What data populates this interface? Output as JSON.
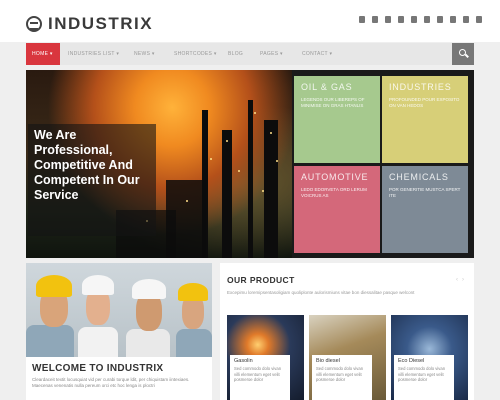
{
  "brand": {
    "name": "INDUSTRIX"
  },
  "social_icons": [
    "rss-icon",
    "facebook-icon",
    "twitter-icon",
    "google-plus-icon",
    "youtube-icon",
    "linkedin-icon",
    "dribbble-icon",
    "flickr-icon",
    "lock-icon",
    "user-icon"
  ],
  "nav": {
    "items": [
      {
        "label": "HOME ▾",
        "active": true
      },
      {
        "label": "INDUSTRIES LIST ▾",
        "active": false
      },
      {
        "label": "NEWS ▾",
        "active": false
      },
      {
        "label": "SHORTCODES ▾",
        "active": false
      },
      {
        "label": "BLOG",
        "active": false
      },
      {
        "label": "PAGES ▾",
        "active": false
      },
      {
        "label": "CONTACT ▾",
        "active": false
      }
    ]
  },
  "hero": {
    "lines": [
      "We Are",
      "Professional,",
      "Competitive And",
      "Competent In Our",
      "Service"
    ]
  },
  "tiles": [
    {
      "title": "OIL & GAS",
      "text": "LEGENDS OUR LIBEREPS OF MINIMISE ON GRAS HTANLIS"
    },
    {
      "title": "INDUSTRIES",
      "text": "PROFOUNDED POUR EXPOSITO ON VAN HEDOS"
    },
    {
      "title": "AUTOMOTIVE",
      "text": "LEDO EDORVETA ORD LERUM VOICRUS AS"
    },
    {
      "title": "CHEMICALS",
      "text": "POR GENERITIE MUSTCA SPERT ITE"
    }
  ],
  "welcome": {
    "title": "WELCOME TO INDUSTRIX",
    "text": "Cleardaceit textit locusquiat vid per curabi torque ldit, per chiquistam iintexiaes. Maecenas venenatis nulla pereum orci etc hoc lenga is ploctri"
  },
  "product": {
    "title": "OUR PRODUCT",
    "intro": "Excepimu loremipsentasoligiam quoliplonte aulorismiuns vitae bon diessalitae pasque welcont",
    "cards": [
      {
        "title": "Gasolin",
        "text": "Sed commodo dolo vivan villi elementum eget velit posmeroe dolor"
      },
      {
        "title": "Bio diesel",
        "text": "Sed commodo dolo vivan villi elementum eget velit posmeroe dolor"
      },
      {
        "title": "Eco Diesel",
        "text": "Sed commodo dolo vivan villi elementum eget velit posmeroe dolor"
      }
    ]
  },
  "colors": {
    "accent": "#d9363e",
    "tile_oil": "#a6c98e",
    "tile_industries": "#d7cf78",
    "tile_automotive": "#d4687a",
    "tile_chemicals": "#7e8a96"
  }
}
